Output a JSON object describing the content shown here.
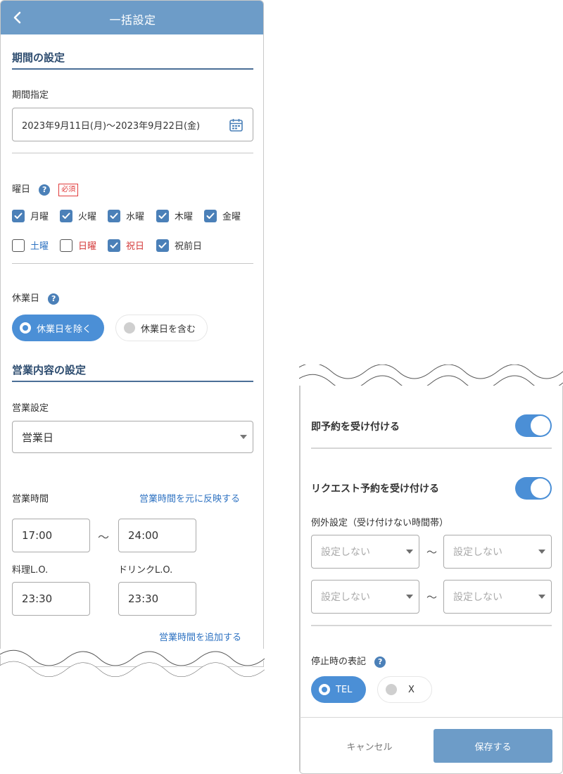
{
  "header": {
    "title": "一括設定"
  },
  "period": {
    "section_title": "期間の設定",
    "label": "期間指定",
    "value": "2023年9月11日(月)〜2023年9月22日(金)"
  },
  "weekdays": {
    "label": "曜日",
    "required_badge": "必須",
    "items": [
      {
        "label": "月曜",
        "checked": true,
        "color": "#333333"
      },
      {
        "label": "火曜",
        "checked": true,
        "color": "#333333"
      },
      {
        "label": "水曜",
        "checked": true,
        "color": "#333333"
      },
      {
        "label": "木曜",
        "checked": true,
        "color": "#333333"
      },
      {
        "label": "金曜",
        "checked": true,
        "color": "#333333"
      },
      {
        "label": "土曜",
        "checked": false,
        "color": "#2f73c2"
      },
      {
        "label": "日曜",
        "checked": false,
        "color": "#d43a3a"
      },
      {
        "label": "祝日",
        "checked": true,
        "color": "#d43a3a"
      },
      {
        "label": "祝前日",
        "checked": true,
        "color": "#333333"
      }
    ]
  },
  "holiday": {
    "label": "休業日",
    "options": [
      {
        "label": "休業日を除く",
        "selected": true
      },
      {
        "label": "休業日を含む",
        "selected": false
      }
    ]
  },
  "business": {
    "section_title": "営業内容の設定",
    "setting_label": "営業設定",
    "setting_value": "営業日",
    "hours_label": "営業時間",
    "reflect_link": "営業時間を元に反映する",
    "start_time": "17:00",
    "range_separator": "〜",
    "end_time": "24:00",
    "food_lo_label": "料理L.O.",
    "food_lo_value": "23:30",
    "drink_lo_label": "ドリンクL.O.",
    "drink_lo_value": "23:30",
    "add_hours_link": "営業時間を追加する"
  },
  "reservation": {
    "instant_label": "即予約を受け付ける",
    "instant_on": true,
    "request_label": "リクエスト予約を受け付ける",
    "request_on": true,
    "exception_label": "例外設定（受け付けない時間帯）",
    "exception_rows": [
      {
        "from": "設定しない",
        "to": "設定しない"
      },
      {
        "from": "設定しない",
        "to": "設定しない"
      }
    ],
    "range_separator": "〜",
    "stop_label": "停止時の表記",
    "stop_options": [
      {
        "label": "TEL",
        "selected": true
      },
      {
        "label": "X",
        "selected": false
      }
    ]
  },
  "footer": {
    "cancel_label": "キャンセル",
    "save_label": "保存する"
  },
  "colors": {
    "header_bg": "#6d9cc8",
    "accent": "#4b8fd6",
    "link": "#2f73c2",
    "section_title": "#2d4c6f",
    "required": "#e03c3c"
  }
}
